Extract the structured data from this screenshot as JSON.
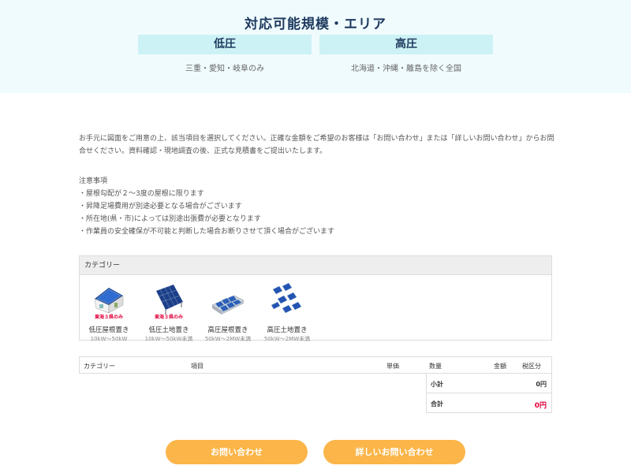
{
  "hero": {
    "title": "対応可能規模・エリア",
    "low": {
      "label": "低圧",
      "area": "三重・愛知・岐阜のみ"
    },
    "high": {
      "label": "高圧",
      "area": "北海道・沖縄・離島を除く全国"
    }
  },
  "intro": "お手元に図面をご用意の上、該当項目を選択してください。正確な金額をご希望のお客様は「お問い合わせ」または「詳しいお問い合わせ」からお問合せください。資料確認・現地調査の後、正式な見積書をご提出いたします。",
  "notes": {
    "title": "注意事項",
    "items": [
      "・屋根勾配が２～3度の屋根に限ります",
      "・昇降足場費用が別途必要となる場合がございます",
      "・所在地(県・市)によっては別途出張費が必要となります",
      "・作業員の安全確保が不可能と判断した場合お断りさせて頂く場合がございます"
    ]
  },
  "category": {
    "header": "カテゴリー",
    "items": [
      {
        "name": "低圧屋根置き",
        "range": "10kW～50kW",
        "tag": "東海３県のみ",
        "icon": "house-solar-icon"
      },
      {
        "name": "低圧土地置き",
        "range": "10kW～50kW未満",
        "tag": "東海３県のみ",
        "icon": "ground-solar-icon"
      },
      {
        "name": "高圧屋根置き",
        "range": "50kW～2MW未満",
        "tag": "",
        "icon": "roof-solar-array-icon"
      },
      {
        "name": "高圧土地置き",
        "range": "50kW～2MW未満",
        "tag": "",
        "icon": "ground-solar-array-icon"
      }
    ]
  },
  "table": {
    "columns": [
      "カテゴリー",
      "項目",
      "単価",
      "数量",
      "金額",
      "税区分"
    ],
    "subtotal_label": "小計",
    "subtotal_value": "0円",
    "total_label": "合計",
    "total_value": "0円"
  },
  "buttons": {
    "contact": "お問い合わせ",
    "detail": "詳しいお問い合わせ"
  },
  "colors": {
    "accent": "#fbb548",
    "hero_bg": "#f0fbfe",
    "region_bg": "#ccf2f5",
    "total": "#e0003a"
  }
}
